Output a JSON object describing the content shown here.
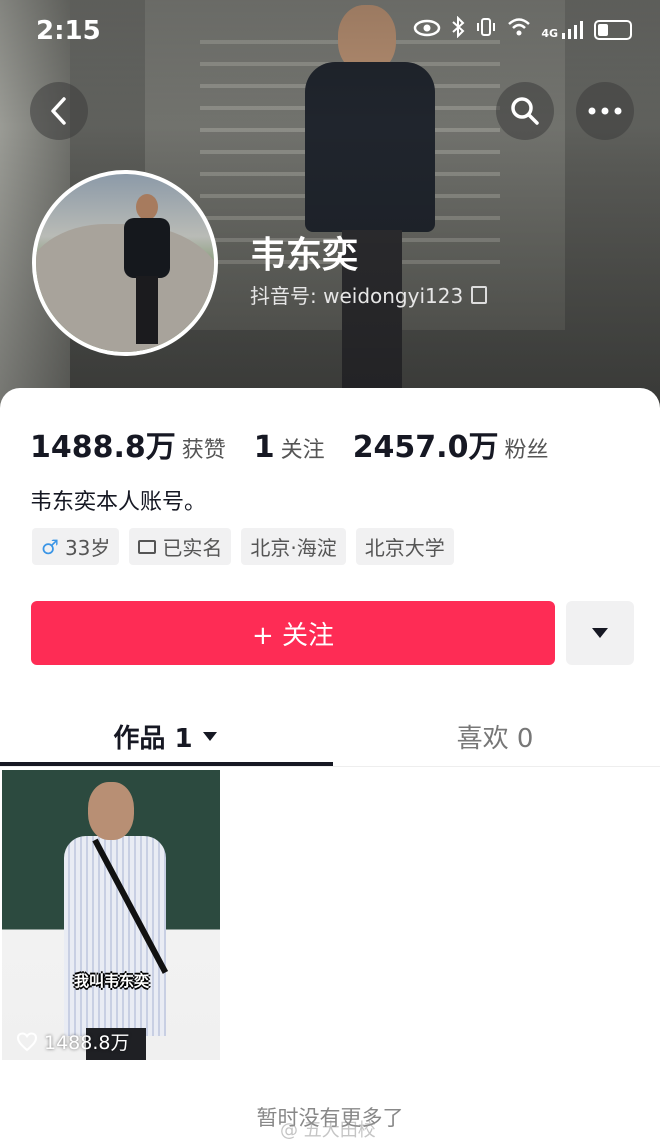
{
  "status_bar": {
    "time": "2:15",
    "network": "4G"
  },
  "profile": {
    "name": "韦东奕",
    "douyin_id": "抖音号: weidongyi123",
    "likes_count": "1488.8万",
    "likes_label": "获赞",
    "following_count": "1",
    "following_label": "关注",
    "followers_count": "2457.0万",
    "followers_label": "粉丝",
    "bio": "韦东奕本人账号。",
    "tags": {
      "age": "33岁",
      "verified": "已实名",
      "location": "北京·海淀",
      "school": "北京大学"
    }
  },
  "actions": {
    "follow_label": "+ 关注"
  },
  "tabs": {
    "works": "作品 1",
    "likes": "喜欢 0"
  },
  "video": {
    "caption": "我叫韦东奕",
    "likes": "1488.8万"
  },
  "footer": {
    "no_more": "暂时没有更多了",
    "watermark": "@ 五大田校"
  }
}
